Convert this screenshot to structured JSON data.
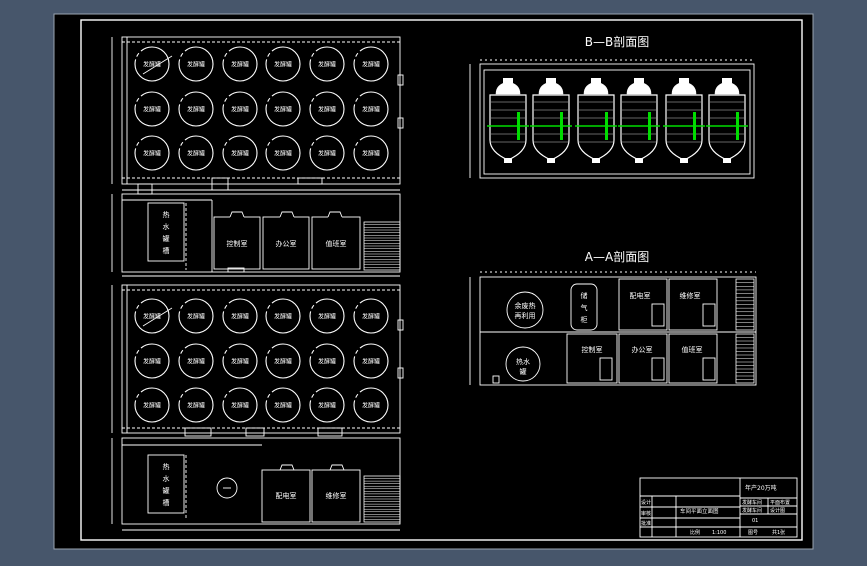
{
  "colors": {
    "background": "#47566b",
    "sheet": "#000000",
    "line": "#ffffff",
    "accent": "#00dd00"
  },
  "sections": {
    "bb_title": "B—B剖面图",
    "aa_title": "A—A剖面图"
  },
  "tank_label": "发酵罐",
  "plan_upper": {
    "hot_water_tank": [
      "热",
      "水",
      "罐",
      "槽"
    ],
    "rooms": [
      "控制室",
      "办公室",
      "值班室"
    ]
  },
  "plan_lower": {
    "hot_water_tank": [
      "热",
      "水",
      "罐",
      "槽"
    ],
    "rooms": [
      "配电室",
      "维修室"
    ]
  },
  "section_aa": {
    "upper_tank": [
      "余废热",
      "再利用"
    ],
    "tall_tank": [
      "储",
      "气",
      "柜"
    ],
    "lower_tank": [
      "热水",
      "罐"
    ],
    "upper_rooms": [
      "配电室",
      "维修室"
    ],
    "lower_rooms": [
      "控制室",
      "办公室",
      "值班室"
    ]
  },
  "title_block": {
    "project": "年产20万吨",
    "line2a": "发酵车间",
    "line2b": "平面布置",
    "line3a": "发酵车间",
    "line3b": "设计图",
    "scale_label": "比例",
    "scale_value": "1:100",
    "drawing": "车间平面立面图",
    "design": "设计",
    "check": "审核",
    "approve": "批准",
    "number": "01",
    "sheet_label": "图号",
    "total_label": "共1张"
  }
}
